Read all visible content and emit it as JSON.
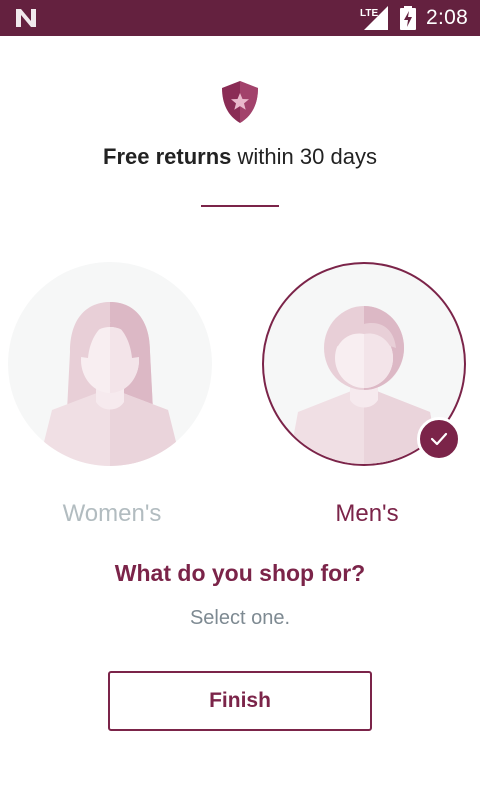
{
  "status_bar": {
    "time": "2:08",
    "network_label": "LTE",
    "notification_icon": "n-logo-icon",
    "signal_icon": "signal-icon",
    "battery_icon": "battery-charging-icon",
    "background_color": "#64213f"
  },
  "promo": {
    "icon": "shield-star-icon",
    "bold_text": "Free returns",
    "rest_text": " within 30 days"
  },
  "options": [
    {
      "label": "Women's",
      "icon": "woman-avatar-icon",
      "selected": false
    },
    {
      "label": "Men's",
      "icon": "man-avatar-icon",
      "selected": true
    }
  ],
  "question": "What do you shop for?",
  "hint": "Select one.",
  "finish_label": "Finish",
  "colors": {
    "accent": "#7b2449",
    "muted_text": "#b2bcc0",
    "hint_text": "#7e8a92",
    "circle_bg": "#f6f7f7"
  }
}
